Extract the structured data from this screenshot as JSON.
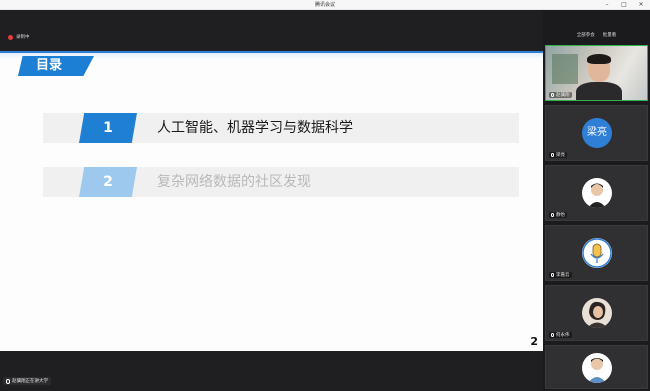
{
  "window": {
    "title": "腾讯会议"
  },
  "toolbar": {
    "recording_label": "录制中"
  },
  "slide": {
    "section_title": "目录",
    "items": [
      {
        "number": "1",
        "title": "人工智能、机器学习与数据科学"
      },
      {
        "number": "2",
        "title": "复杂网络数据的社区发现"
      }
    ],
    "page_number": "2"
  },
  "bottom": {
    "speaker_text": "赵骥翔正在讲大学"
  },
  "sidebar": {
    "tabs": [
      "全部参会",
      "批量看"
    ],
    "participants": [
      {
        "name": "赵骥翔",
        "avatar_text": ""
      },
      {
        "name": "梁亮",
        "avatar_text": "梁亮"
      },
      {
        "name": "静怡",
        "avatar_text": ""
      },
      {
        "name": "李嘉云",
        "avatar_text": ""
      },
      {
        "name": "何永伟",
        "avatar_text": ""
      },
      {
        "name": "",
        "avatar_text": ""
      }
    ]
  },
  "colors": {
    "accent": "#1f7fd2",
    "faded_accent": "#9ec9ee",
    "active_border": "#2fb34e"
  }
}
